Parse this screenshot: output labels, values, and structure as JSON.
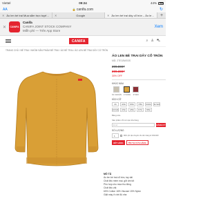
{
  "status": {
    "carrier": "Viettel",
    "time": "09:24",
    "battery": "44%"
  },
  "browser": {
    "aa": "AA",
    "url": "canifa.com",
    "tabs": [
      {
        "label": "Áo len bé trai Mua sắm trực tuyến Nhưng c...",
        "active": false
      },
      {
        "label": "Google",
        "active": false
      },
      {
        "label": "Áo len bé trai dây cổ tròn – Áo len b...",
        "active": true
      }
    ]
  },
  "banner": {
    "name": "Canifa",
    "publisher": "CANIFA JOINT STOCK COMPANY",
    "store": "Miễn phí — Trên App Store",
    "view": "Xem",
    "logo_text": "CANIFA"
  },
  "site": {
    "logo": "CANIFA"
  },
  "breadcrumb": "TRANG CHỦ / BÉ TRAI / NHÓM SẢN PHẨM BÉ TRAI / ÁO BÉ TRAI / ÁO LEN BÉ TRAI DÂY CỔ TRÒN",
  "product": {
    "title": "ÁO LEN BÉ TRAI DÂY CỔ TRÒN",
    "sku": "MÃ: 2TE18W03S",
    "price_old": "299.000₫",
    "price_new": "209.300₫",
    "discount": "30% OFF",
    "color_label": "KHÚC MÀU",
    "colors": [
      {
        "code": "01 CHUẨN",
        "hex": "#c9c2b2"
      },
      {
        "code": "2 VÀNG",
        "hex": "#d9a33c"
      },
      {
        "code": "2Y023",
        "hex": "#8c2f34"
      }
    ],
    "size_label": "KÍCH CỠ",
    "sizes": [
      "2A",
      "3/4A",
      "5/6A",
      "7/8A",
      "9/10A",
      "11/12A",
      "13/14A",
      "2/3A",
      "4/5A",
      "6/7A",
      "8/9A"
    ],
    "size_guide": "Bảng size",
    "notice": "Sản phẩm chỉ còn tại cửa hàng",
    "notify_placeholder": "Email",
    "notify_button": "ĐĂNG KÝ",
    "qty_label": "SỐ LƯỢNG",
    "qty_value": "1",
    "qty_note": "Miễn phí vận chuyển cho đơn hàng từ 499.000₫",
    "buy_button": "HẾT HÀNG",
    "store_button": "TÌM TẠI CỬA HÀNG",
    "sweater_color": "#d99f36"
  },
  "description": {
    "title": "MÔ TẢ",
    "lines": [
      "Áo len bé trai cổ tròn, tay dài",
      "Chất liệu mềm mại, giữ ấm tốt",
      "Phù hợp cho mùa thu đông",
      "Chất liệu vải:",
      "60% Cotton 16% Viscose 15% Nylon",
      "Giặt máy ở chế độ nhẹ"
    ]
  }
}
